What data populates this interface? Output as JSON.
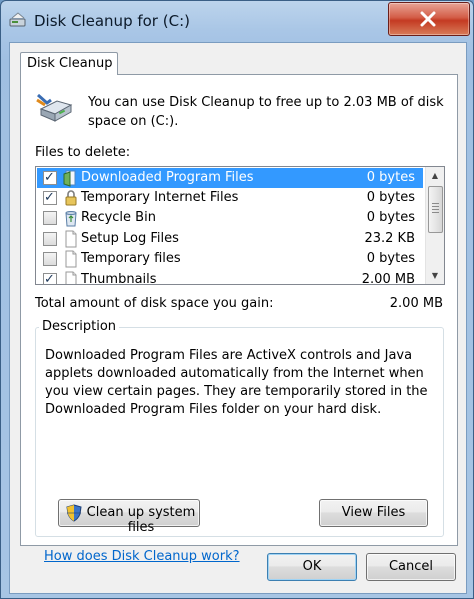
{
  "window": {
    "title": "Disk Cleanup for  (C:)",
    "close_glyph": "✕"
  },
  "tab": {
    "label": "Disk Cleanup"
  },
  "intro_text": "You can use Disk Cleanup to free up to 2.03 MB of disk space on  (C:).",
  "files_to_delete_label": "Files to delete:",
  "files": [
    {
      "name": "Downloaded Program Files",
      "size": "0 bytes",
      "checked": true,
      "selected": true,
      "icon": "folder-icon"
    },
    {
      "name": "Temporary Internet Files",
      "size": "0 bytes",
      "checked": true,
      "selected": false,
      "icon": "lock-icon"
    },
    {
      "name": "Recycle Bin",
      "size": "0 bytes",
      "checked": false,
      "selected": false,
      "icon": "recycle-bin-icon"
    },
    {
      "name": "Setup Log Files",
      "size": "23.2 KB",
      "checked": false,
      "selected": false,
      "icon": "document-icon"
    },
    {
      "name": "Temporary files",
      "size": "0 bytes",
      "checked": false,
      "selected": false,
      "icon": "document-icon"
    },
    {
      "name": "Thumbnails",
      "size": "2.00 MB",
      "checked": true,
      "selected": false,
      "icon": "document-icon"
    }
  ],
  "total_label": "Total amount of disk space you gain:",
  "total_value": "2.00 MB",
  "description": {
    "title": "Description",
    "text": "Downloaded Program Files are ActiveX controls and Java applets downloaded automatically from the Internet when you view certain pages. They are temporarily stored in the Downloaded Program Files folder on your hard disk."
  },
  "buttons": {
    "cleanup_system_files": "Clean up system files",
    "view_files": "View Files",
    "ok": "OK",
    "cancel": "Cancel"
  },
  "help_link": "How does Disk Cleanup work?",
  "colors": {
    "selection": "#3399ff",
    "link": "#0066cc",
    "close_button": "#c43a22"
  }
}
